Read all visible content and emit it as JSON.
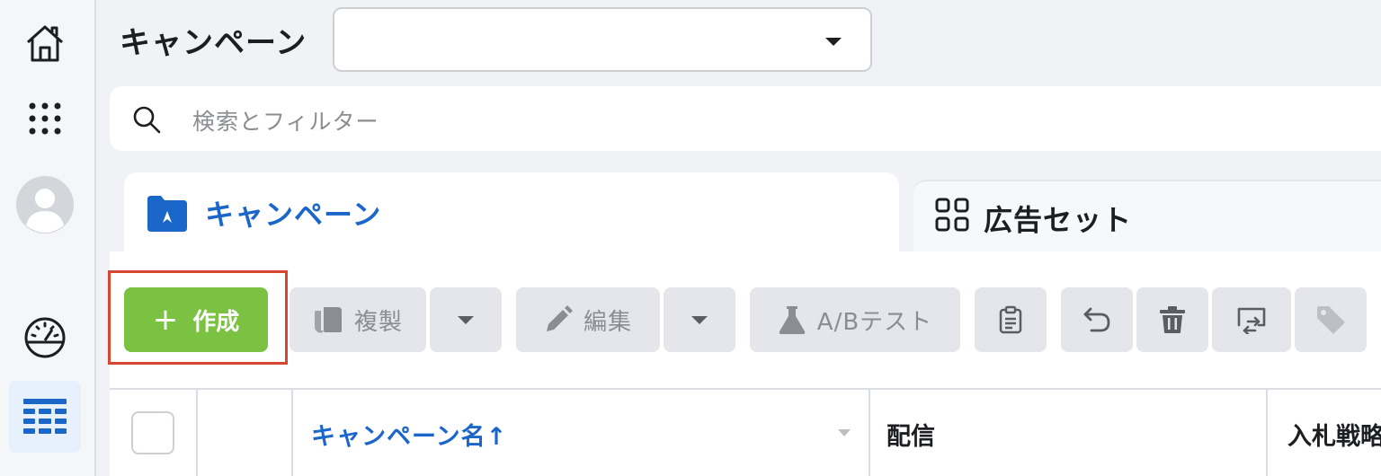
{
  "header": {
    "title": "キャンペーン",
    "campaign_select_value": ""
  },
  "search": {
    "placeholder": "検索とフィルター"
  },
  "tabs": [
    {
      "label": "キャンペーン",
      "icon": "folder-icon",
      "active": true
    },
    {
      "label": "広告セット",
      "icon": "grid-icon",
      "active": false
    }
  ],
  "toolbar": {
    "create_label": "作成",
    "duplicate_label": "複製",
    "edit_label": "編集",
    "ab_test_label": "A/Bテスト"
  },
  "table": {
    "columns": [
      "キャンペーン名↑",
      "配信",
      "入札戦略"
    ]
  },
  "colors": {
    "accent": "#1b66c9",
    "create_green": "#7cc242",
    "highlight_red": "#d9462f"
  }
}
